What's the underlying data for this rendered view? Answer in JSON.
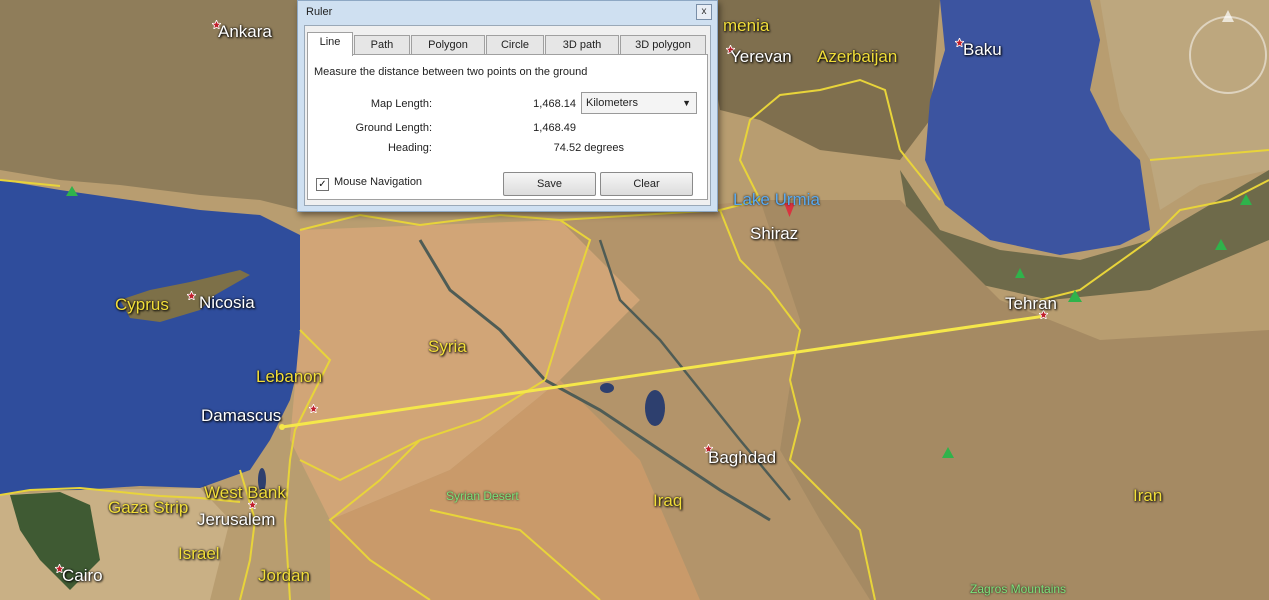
{
  "ruler": {
    "title": "Ruler",
    "close_glyph": "x",
    "tabs": [
      {
        "label": "Line",
        "active": true
      },
      {
        "label": "Path",
        "active": false
      },
      {
        "label": "Polygon",
        "active": false
      },
      {
        "label": "Circle",
        "active": false
      },
      {
        "label": "3D path",
        "active": false
      },
      {
        "label": "3D polygon",
        "active": false
      }
    ],
    "description": "Measure the distance between two points on the ground",
    "map_length_label": "Map Length:",
    "map_length_value": "1,468.14",
    "units": "Kilometers",
    "ground_length_label": "Ground Length:",
    "ground_length_value": "1,468.49",
    "heading_label": "Heading:",
    "heading_value": "74.52 degrees",
    "mouse_nav_label": "Mouse Navigation",
    "mouse_nav_checked": true,
    "save_label": "Save",
    "clear_label": "Clear"
  },
  "map": {
    "cities": [
      "Ankara",
      "Yerevan",
      "Baku",
      "Nicosia",
      "Damascus",
      "Jerusalem",
      "Cairo",
      "Baghdad",
      "Tehran",
      "Shiraz"
    ],
    "countries": [
      "Azerbaijan",
      "Cyprus",
      "Lebanon",
      "Syria",
      "West Bank",
      "Gaza Strip",
      "Israel",
      "Jordan",
      "Iraq",
      "Iran",
      "menia"
    ],
    "terrain": [
      "Syrian Desert",
      "Zagros Mountains"
    ],
    "water": [
      "Lake Urmia"
    ],
    "colors": {
      "measure_line": "#f5e74a",
      "border": "#e8d43a",
      "sea": "#3552a8",
      "land": "#b59a6f"
    }
  }
}
